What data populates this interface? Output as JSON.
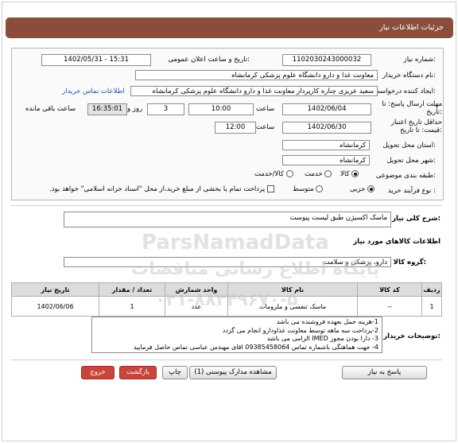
{
  "header": {
    "title": "جزئیات اطلاعات نیاز"
  },
  "fields": {
    "need_number_label": "شماره نیاز:",
    "need_number": "1102030243000032",
    "announce_label": "تاریخ و ساعت اعلان عمومی:",
    "announce_value": "1402/05/31 - 15:31",
    "buyer_label": "نام دستگاه خریدار:",
    "buyer": "معاونت غذا و دارو دانشگاه علوم پزشکی کرمانشاه",
    "creator_label": "ایجاد کننده درخواست:",
    "creator": "سعید عزیزی چناره کارپرداز معاونت غذا و دارو دانشگاه علوم پزشکی کرمانشاه",
    "contact_link": "اطلاعات تماس خریدار",
    "reply_deadline_label": "مهلت ارسال پاسخ: تا تاریخ:",
    "reply_date": "1402/06/04",
    "time_label": "ساعت",
    "reply_time": "10:00",
    "days_value": "3",
    "days_label": "روز و",
    "remaining_time": "16:35:01",
    "remaining_label": "ساعت باقی مانده",
    "validity_label": "حداقل تاریخ اعتبار قیمت: تا تاریخ:",
    "validity_date": "1402/06/30",
    "validity_time": "12:00",
    "province_label": "استان محل تحویل:",
    "province": "کرمانشاه",
    "city_label": "شهر محل تحویل:",
    "city": "کرمانشاه",
    "category_label": "طبقه بندی موضوعی:",
    "category_options": [
      "کالا",
      "خدمت",
      "کالا/خدمت"
    ],
    "process_label": "نوع فرآیند خرید :",
    "process_options": [
      "جزیی",
      "متوسط"
    ],
    "payment_note": "پرداخت تمام یا بخشی از مبلغ خرید،از محل \"اسناد خزانه اسلامی\" خواهد بود."
  },
  "summary": {
    "label": "شرح کلی نیاز:",
    "value": "ماسک اکسیژن طبق لیست پیوست"
  },
  "goods": {
    "section_title": "اطلاعات کالاهای مورد نیاز",
    "group_label": "گروه کالا:",
    "group_value": "دارو، پزشکی و سلامت",
    "columns": [
      "ردیف",
      "کد کالا",
      "نام کالا",
      "واحد شمارش",
      "تعداد / مقدار",
      "تاریخ نیاز"
    ],
    "rows": [
      {
        "row": "1",
        "code": "--",
        "name": "ماسک تنفسی و ملزومات",
        "unit": "عدد",
        "qty": "1",
        "date": "1402/06/06"
      }
    ]
  },
  "notes": {
    "label": "توضیحات خریدار:",
    "lines": [
      "1-هزینه حمل بعهده فروشنده می باشد",
      "2-پرداخت سه ماهه توسط معاونت غذاودارو انجام می گردد",
      "3- دارا بودن مجوز IMED الزامی می باشد",
      "4- جهت هماهنگی باشماره تماس 09385458064 اقای مهندس عباسی تماس حاصل فرمایید"
    ]
  },
  "buttons": {
    "reply": "پاسخ به نیاز",
    "attachments": "مشاهده مدارک پیوستی (1)",
    "print": "چاپ",
    "back": "بازگشت",
    "exit": "خروج"
  },
  "watermark": {
    "brand": "ParsNamadData",
    "persian": "پایگاه اطلاع رسانی مناقصات",
    "phone": "۰۲۱-۸۸۳۴۹۶۷۰-۵"
  },
  "colors": {
    "title_bg": "#8a4d3c",
    "exit_button": "#c8453b",
    "link": "#1a4fa0"
  }
}
